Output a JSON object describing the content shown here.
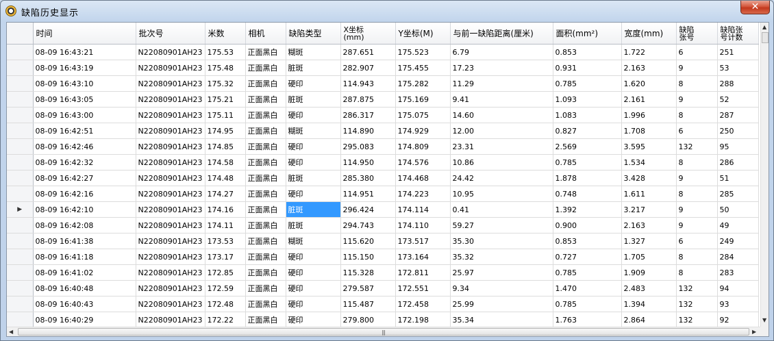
{
  "window": {
    "title": "缺陷历史显示",
    "close_glyph": "✕"
  },
  "columns": [
    {
      "key": "time",
      "label": "时间",
      "width": 150
    },
    {
      "key": "batch",
      "label": "批次号",
      "width": 101
    },
    {
      "key": "meters",
      "label": "米数",
      "width": 59
    },
    {
      "key": "camera",
      "label": "相机",
      "width": 59
    },
    {
      "key": "type",
      "label": "缺陷类型",
      "width": 80
    },
    {
      "key": "x",
      "label": "X坐标\n(mm)",
      "width": 80
    },
    {
      "key": "y",
      "label": "Y坐标(M)",
      "width": 80
    },
    {
      "key": "dist",
      "label": "与前一缺陷距离(厘米)",
      "width": 150
    },
    {
      "key": "area",
      "label": "面积(mm²)",
      "width": 100
    },
    {
      "key": "width",
      "label": "宽度(mm)",
      "width": 80
    },
    {
      "key": "sheet",
      "label": "缺陷\n张号",
      "width": 60
    },
    {
      "key": "count",
      "label": "缺陷张\n号计数",
      "width": 60
    }
  ],
  "current_row_indicator": "▶",
  "selected": {
    "row": 10,
    "col": "type"
  },
  "rows": [
    {
      "time": "08-09 16:43:21",
      "batch": "N22080901AH23",
      "meters": "175.53",
      "camera": "正面黑白",
      "type": "糊斑",
      "x": "287.651",
      "y": "175.523",
      "dist": "6.79",
      "area": "0.853",
      "width": "1.722",
      "sheet": "6",
      "count": "251"
    },
    {
      "time": "08-09 16:43:19",
      "batch": "N22080901AH23",
      "meters": "175.48",
      "camera": "正面黑白",
      "type": "脏斑",
      "x": "282.907",
      "y": "175.455",
      "dist": "17.23",
      "area": "0.931",
      "width": "2.163",
      "sheet": "9",
      "count": "53"
    },
    {
      "time": "08-09 16:43:10",
      "batch": "N22080901AH23",
      "meters": "175.32",
      "camera": "正面黑白",
      "type": "硬印",
      "x": "114.943",
      "y": "175.282",
      "dist": "11.29",
      "area": "0.785",
      "width": "1.620",
      "sheet": "8",
      "count": "288"
    },
    {
      "time": "08-09 16:43:05",
      "batch": "N22080901AH23",
      "meters": "175.21",
      "camera": "正面黑白",
      "type": "脏斑",
      "x": "287.875",
      "y": "175.169",
      "dist": "9.41",
      "area": "1.093",
      "width": "2.161",
      "sheet": "9",
      "count": "52"
    },
    {
      "time": "08-09 16:43:00",
      "batch": "N22080901AH23",
      "meters": "175.11",
      "camera": "正面黑白",
      "type": "硬印",
      "x": "286.317",
      "y": "175.075",
      "dist": "14.60",
      "area": "1.083",
      "width": "1.996",
      "sheet": "8",
      "count": "287"
    },
    {
      "time": "08-09 16:42:51",
      "batch": "N22080901AH23",
      "meters": "174.95",
      "camera": "正面黑白",
      "type": "糊斑",
      "x": "114.890",
      "y": "174.929",
      "dist": "12.00",
      "area": "0.827",
      "width": "1.708",
      "sheet": "6",
      "count": "250"
    },
    {
      "time": "08-09 16:42:46",
      "batch": "N22080901AH23",
      "meters": "174.85",
      "camera": "正面黑白",
      "type": "硬印",
      "x": "295.083",
      "y": "174.809",
      "dist": "23.31",
      "area": "2.569",
      "width": "3.595",
      "sheet": "132",
      "count": "95"
    },
    {
      "time": "08-09 16:42:32",
      "batch": "N22080901AH23",
      "meters": "174.58",
      "camera": "正面黑白",
      "type": "硬印",
      "x": "114.950",
      "y": "174.576",
      "dist": "10.86",
      "area": "0.785",
      "width": "1.534",
      "sheet": "8",
      "count": "286"
    },
    {
      "time": "08-09 16:42:27",
      "batch": "N22080901AH23",
      "meters": "174.48",
      "camera": "正面黑白",
      "type": "脏斑",
      "x": "285.380",
      "y": "174.468",
      "dist": "24.42",
      "area": "1.878",
      "width": "3.428",
      "sheet": "9",
      "count": "51"
    },
    {
      "time": "08-09 16:42:16",
      "batch": "N22080901AH23",
      "meters": "174.27",
      "camera": "正面黑白",
      "type": "硬印",
      "x": "114.951",
      "y": "174.223",
      "dist": "10.95",
      "area": "0.748",
      "width": "1.611",
      "sheet": "8",
      "count": "285"
    },
    {
      "time": "08-09 16:42:10",
      "batch": "N22080901AH23",
      "meters": "174.16",
      "camera": "正面黑白",
      "type": "脏斑",
      "x": "296.424",
      "y": "174.114",
      "dist": "0.41",
      "area": "1.392",
      "width": "3.217",
      "sheet": "9",
      "count": "50"
    },
    {
      "time": "08-09 16:42:08",
      "batch": "N22080901AH23",
      "meters": "174.11",
      "camera": "正面黑白",
      "type": "脏斑",
      "x": "294.743",
      "y": "174.110",
      "dist": "59.27",
      "area": "0.900",
      "width": "2.163",
      "sheet": "9",
      "count": "49"
    },
    {
      "time": "08-09 16:41:38",
      "batch": "N22080901AH23",
      "meters": "173.53",
      "camera": "正面黑白",
      "type": "糊斑",
      "x": "115.620",
      "y": "173.517",
      "dist": "35.30",
      "area": "0.853",
      "width": "1.327",
      "sheet": "6",
      "count": "249"
    },
    {
      "time": "08-09 16:41:18",
      "batch": "N22080901AH23",
      "meters": "173.17",
      "camera": "正面黑白",
      "type": "硬印",
      "x": "115.150",
      "y": "173.164",
      "dist": "35.32",
      "area": "0.727",
      "width": "1.705",
      "sheet": "8",
      "count": "284"
    },
    {
      "time": "08-09 16:41:02",
      "batch": "N22080901AH23",
      "meters": "172.85",
      "camera": "正面黑白",
      "type": "硬印",
      "x": "115.328",
      "y": "172.811",
      "dist": "25.97",
      "area": "0.785",
      "width": "1.909",
      "sheet": "8",
      "count": "283"
    },
    {
      "time": "08-09 16:40:48",
      "batch": "N22080901AH23",
      "meters": "172.59",
      "camera": "正面黑白",
      "type": "硬印",
      "x": "279.587",
      "y": "172.551",
      "dist": "9.34",
      "area": "1.470",
      "width": "2.483",
      "sheet": "132",
      "count": "94"
    },
    {
      "time": "08-09 16:40:43",
      "batch": "N22080901AH23",
      "meters": "172.48",
      "camera": "正面黑白",
      "type": "硬印",
      "x": "115.487",
      "y": "172.458",
      "dist": "25.99",
      "area": "0.785",
      "width": "1.394",
      "sheet": "132",
      "count": "93"
    },
    {
      "time": "08-09 16:40:29",
      "batch": "N22080901AH23",
      "meters": "172.22",
      "camera": "正面黑白",
      "type": "硬印",
      "x": "279.800",
      "y": "172.198",
      "dist": "35.34",
      "area": "1.763",
      "width": "2.864",
      "sheet": "132",
      "count": "92"
    }
  ],
  "scrollbars": {
    "up_arrow": "▲",
    "down_arrow": "▼",
    "left_arrow": "◀",
    "right_arrow": "▶",
    "grip": "|||"
  }
}
